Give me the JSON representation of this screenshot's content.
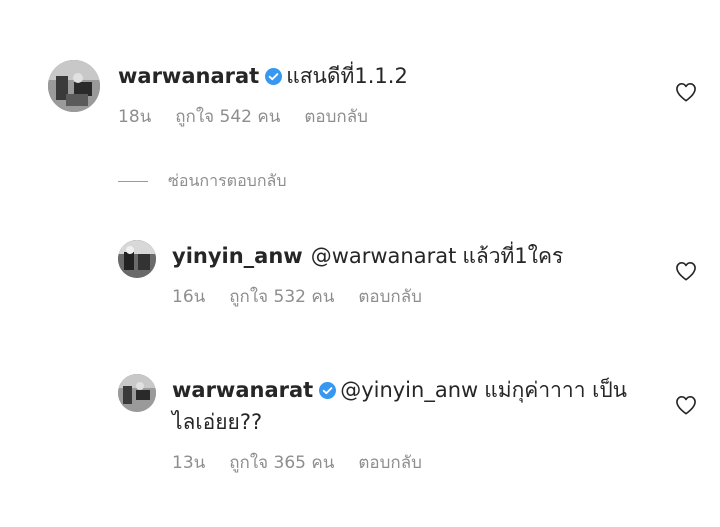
{
  "comments": [
    {
      "username": "warwanarat",
      "verified": true,
      "text": "แสนดีที่1.1.2",
      "time": "18น",
      "likes": "ถูกใจ 542 คน",
      "reply": "ตอบกลับ"
    },
    {
      "username": "yinyin_anw",
      "verified": false,
      "mention": "@warwanarat",
      "text": "แล้วที่1ใคร",
      "time": "16น",
      "likes": "ถูกใจ 532 คน",
      "reply": "ตอบกลับ"
    },
    {
      "username": "warwanarat",
      "verified": true,
      "mention": "@yinyin_anw",
      "text": "แม่กุค่าาาา เป็น",
      "text_line2": "ไลเอ่ยย??",
      "time": "13น",
      "likes": "ถูกใจ 365 คน",
      "reply": "ตอบกลับ"
    }
  ],
  "hide_replies_label": "ซ่อนการตอบกลับ",
  "icons": {
    "verified": "verified-badge-icon",
    "like": "heart-outline-icon"
  },
  "colors": {
    "text": "#262626",
    "secondary": "#8e8e8e",
    "verified_blue": "#3897f0"
  }
}
